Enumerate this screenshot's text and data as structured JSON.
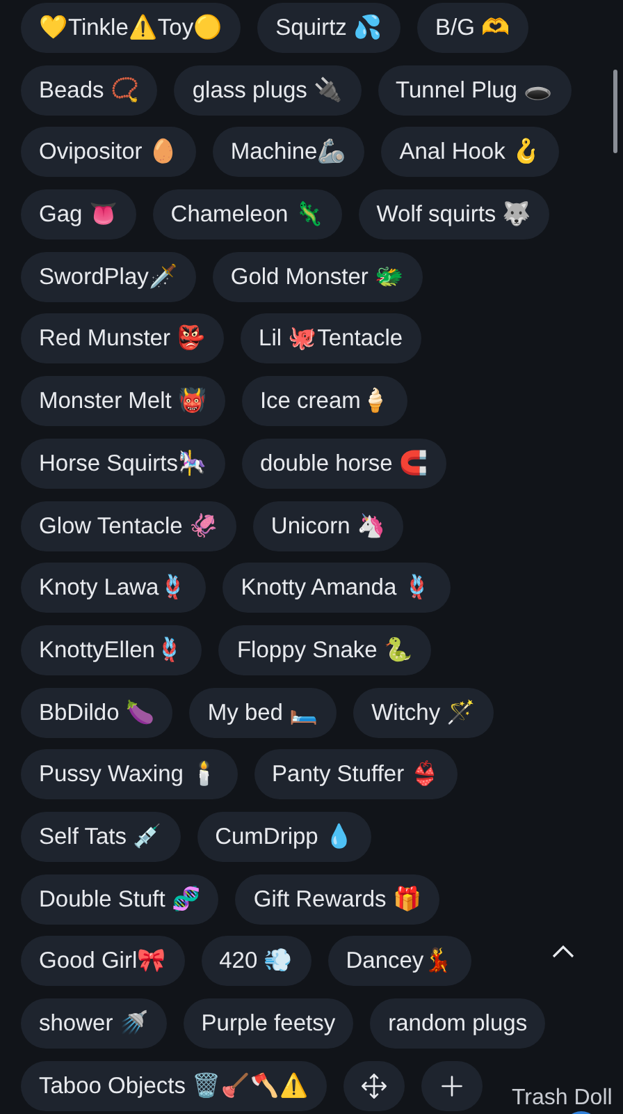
{
  "tag_rows": [
    [
      {
        "label": "💛Tinkle⚠️Toy🟡"
      },
      {
        "label": "Squirtz 💦"
      },
      {
        "label": "B/G 🫶"
      }
    ],
    [
      {
        "label": "Beads 📿"
      },
      {
        "label": "glass plugs 🔌"
      },
      {
        "label": "Tunnel Plug 🕳️"
      }
    ],
    [
      {
        "label": "Ovipositor 🥚"
      },
      {
        "label": "Machine🦾"
      },
      {
        "label": "Anal Hook 🪝"
      }
    ],
    [
      {
        "label": "Gag 👅"
      },
      {
        "label": "Chameleon 🦎"
      },
      {
        "label": "Wolf squirts 🐺"
      }
    ],
    [
      {
        "label": "SwordPlay🗡️"
      },
      {
        "label": "Gold Monster 🐲"
      }
    ],
    [
      {
        "label": "Red Munster 👺"
      },
      {
        "label": "Lil 🐙Tentacle"
      }
    ],
    [
      {
        "label": "Monster Melt 👹"
      },
      {
        "label": "Ice cream🍦"
      }
    ],
    [
      {
        "label": "Horse Squirts🎠"
      },
      {
        "label": "double horse 🧲"
      }
    ],
    [
      {
        "label": "Glow Tentacle 🦑"
      },
      {
        "label": "Unicorn 🦄"
      }
    ],
    [
      {
        "label": "Knoty Lawa🪢"
      },
      {
        "label": "Knotty Amanda 🪢"
      }
    ],
    [
      {
        "label": "KnottyEllen🪢"
      },
      {
        "label": "Floppy Snake 🐍"
      }
    ],
    [
      {
        "label": "BbDildo 🍆"
      },
      {
        "label": "My bed 🛏️"
      },
      {
        "label": "Witchy 🪄"
      }
    ],
    [
      {
        "label": "Pussy Waxing 🕯️"
      },
      {
        "label": "Panty Stuffer 👙"
      }
    ],
    [
      {
        "label": "Self Tats 💉"
      },
      {
        "label": "CumDripp 💧"
      }
    ],
    [
      {
        "label": "Double Stuft 🧬"
      },
      {
        "label": "Gift Rewards 🎁"
      }
    ],
    [
      {
        "label": "Good Girl🎀"
      },
      {
        "label": "420 💨"
      },
      {
        "label": "Dancey💃"
      }
    ],
    [
      {
        "label": "shower 🚿"
      },
      {
        "label": "Purple feetsy"
      },
      {
        "label": "random plugs"
      }
    ],
    [
      {
        "label": "Taboo Objects 🗑️🪠🪓⚠️"
      },
      {
        "kind": "move"
      },
      {
        "kind": "add"
      }
    ]
  ],
  "corner_label": "Trash Doll"
}
